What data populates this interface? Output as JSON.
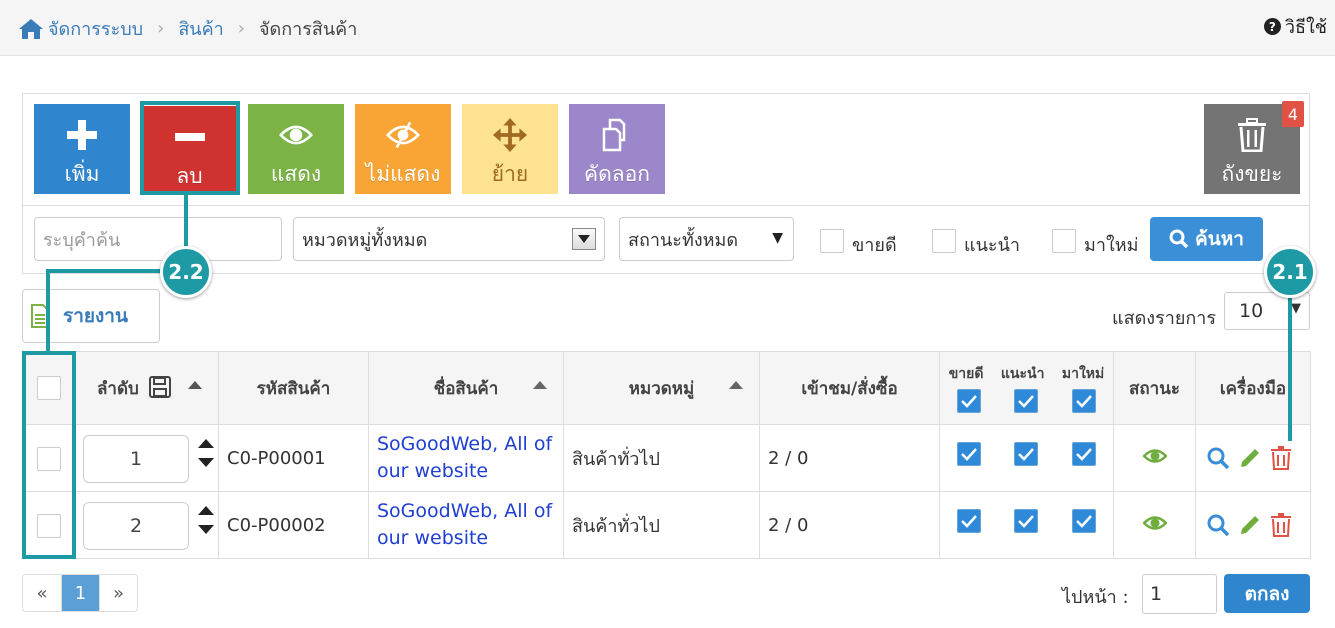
{
  "breadcrumb": {
    "items": [
      "จัดการระบบ",
      "สินค้า"
    ],
    "current": "จัดการสินค้า"
  },
  "help": {
    "label": "วิธีใช้"
  },
  "toolbar": {
    "add": "เพิ่ม",
    "delete": "ลบ",
    "show": "แสดง",
    "hide": "ไม่แสดง",
    "move": "ย้าย",
    "copy": "คัดลอก",
    "trash": "ถังขยะ",
    "trash_count": "4"
  },
  "filters": {
    "search_placeholder": "ระบุคำค้น",
    "category": "หมวดหมู่ทั้งหมด",
    "status": "สถานะทั้งหมด",
    "bestseller": "ขายดี",
    "recommended": "แนะนำ",
    "new": "มาใหม่",
    "search_button": "ค้นหา"
  },
  "report_button": "รายงาน",
  "per_page": {
    "label": "แสดงรายการ",
    "value": "10"
  },
  "table": {
    "headers": {
      "order": "ลำดับ",
      "code": "รหัสสินค้า",
      "name": "ชื่อสินค้า",
      "category": "หมวดหมู่",
      "views": "เข้าชม/สั่งซื้อ",
      "bestseller": "ขายดี",
      "recommended": "แนะนำ",
      "new": "มาใหม่",
      "status": "สถานะ",
      "tools": "เครื่องมือ"
    },
    "rows": [
      {
        "order": "1",
        "code": "C0-P00001",
        "name": "SoGoodWeb, All of our website",
        "category": "สินค้าทั่วไป",
        "views": "2 / 0"
      },
      {
        "order": "2",
        "code": "C0-P00002",
        "name": "SoGoodWeb, All of our website",
        "category": "สินค้าทั่วไป",
        "views": "2 / 0"
      }
    ]
  },
  "pagination": {
    "prev": "«",
    "page": "1",
    "next": "»"
  },
  "goto": {
    "label": "ไปหน้า :",
    "value": "1",
    "button": "ตกลง"
  },
  "annotations": {
    "a1": "2.1",
    "a2": "2.2"
  },
  "colors": {
    "accent": "#2f86cf",
    "annotation": "#1d9aa3",
    "danger": "#d0322f"
  }
}
